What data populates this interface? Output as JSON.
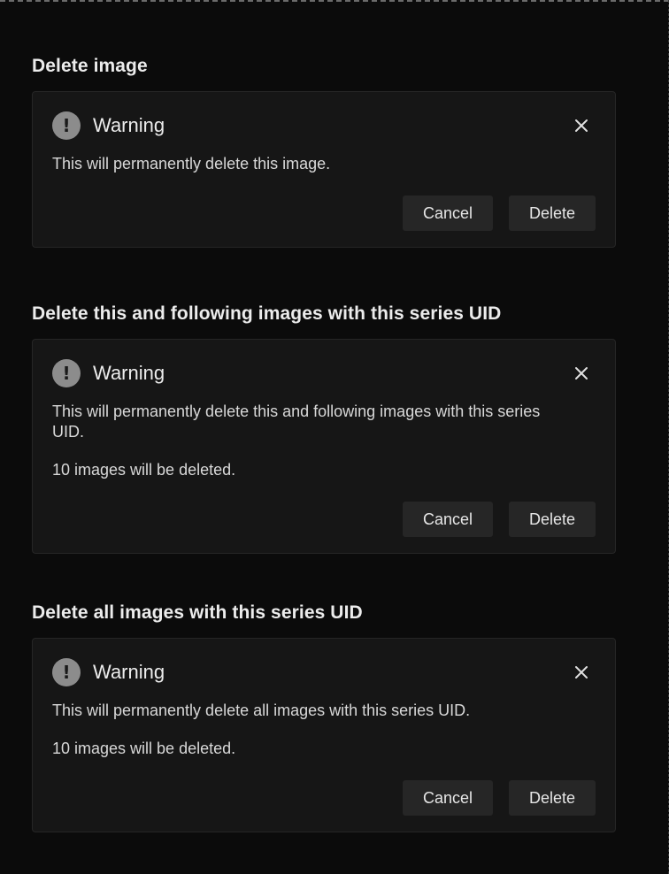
{
  "sections": [
    {
      "title": "Delete image",
      "dialog": {
        "title": "Warning",
        "icon": "warning-icon",
        "close_icon": "close-icon",
        "messages": [
          "This will permanently delete this image."
        ],
        "cancel_label": "Cancel",
        "delete_label": "Delete"
      }
    },
    {
      "title": "Delete this and following images with this series UID",
      "dialog": {
        "title": "Warning",
        "icon": "warning-icon",
        "close_icon": "close-icon",
        "messages": [
          "This will permanently delete this and following images with this series UID.",
          "10 images will be deleted."
        ],
        "cancel_label": "Cancel",
        "delete_label": "Delete"
      }
    },
    {
      "title": "Delete all images with this series UID",
      "dialog": {
        "title": "Warning",
        "icon": "warning-icon",
        "close_icon": "close-icon",
        "messages": [
          "This will permanently delete all images with this series UID.",
          "10 images will be deleted."
        ],
        "cancel_label": "Cancel",
        "delete_label": "Delete"
      }
    }
  ],
  "colors": {
    "background": "#0b0b0b",
    "dialog_background": "#161616",
    "button_background": "#262626",
    "warning_icon": "#8c8c8c",
    "text": "#e6e6e6"
  }
}
